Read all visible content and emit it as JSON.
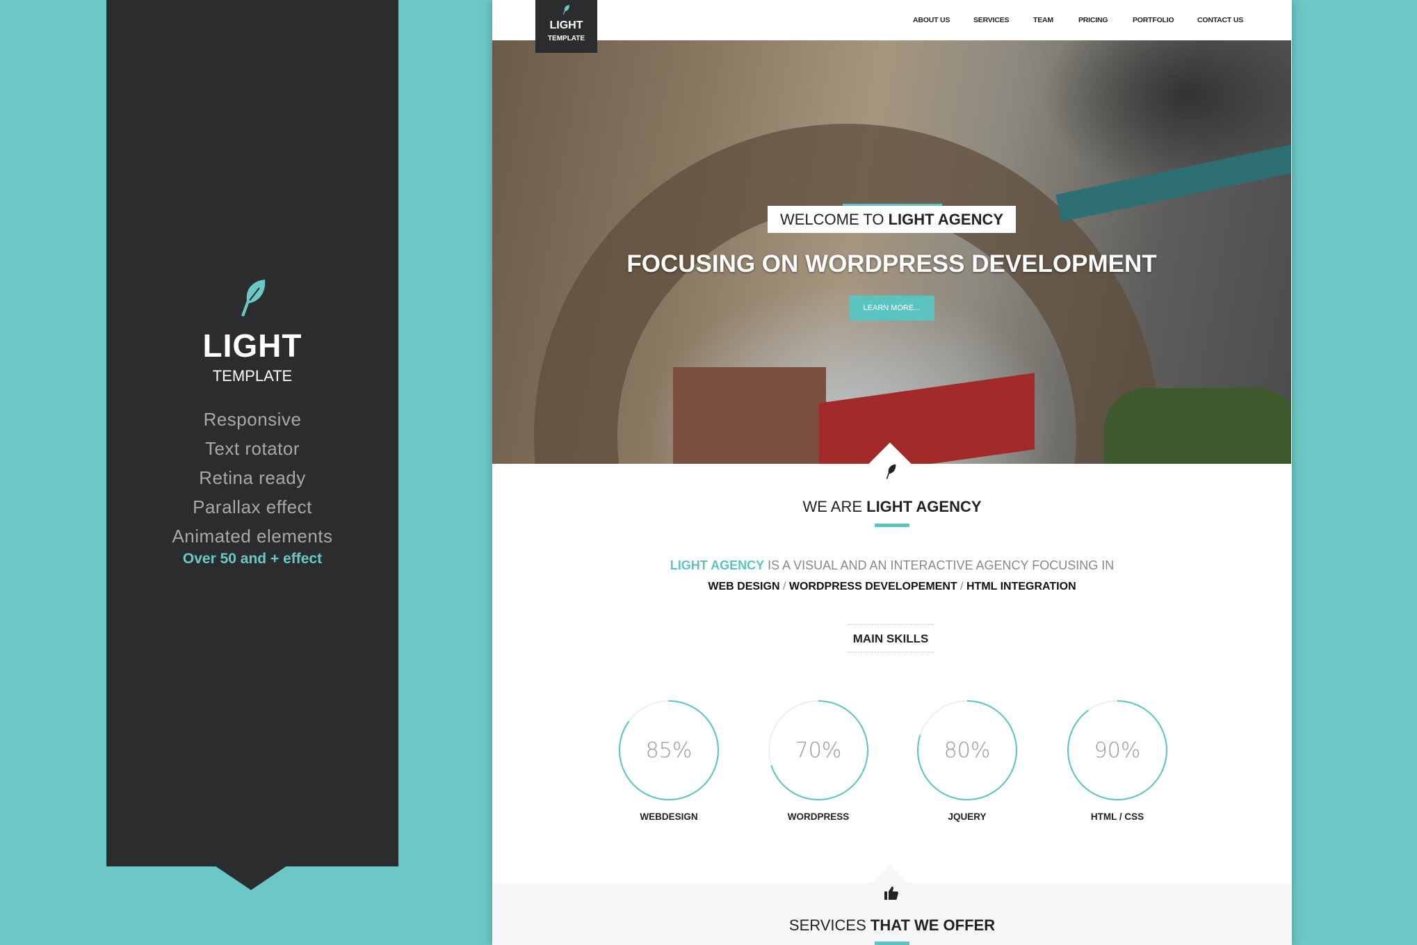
{
  "promo": {
    "title": "LIGHT",
    "subtitle": "TEMPLATE",
    "features": [
      "Responsive",
      "Text rotator",
      "Retina ready",
      "Parallax effect",
      "Animated elements"
    ],
    "extra": "Over 50 and + effect",
    "icon": "feather-icon"
  },
  "site": {
    "logo": {
      "title": "LIGHT",
      "subtitle": "TEMPLATE"
    },
    "nav": [
      "ABOUT US",
      "SERVICES",
      "TEAM",
      "PRICING",
      "PORTFOLIO",
      "CONTACT US"
    ],
    "hero": {
      "welcome_prefix": "WELCOME TO ",
      "welcome_bold": "LIGHT AGENCY",
      "heading": "FOCUSING ON WORDPRESS DEVELOPMENT",
      "button": "LEARN MORE..."
    },
    "about": {
      "title_prefix": "WE ARE ",
      "title_bold": "LIGHT AGENCY",
      "highlight": "LIGHT AGENCY",
      "text": " IS A VISUAL AND AN INTERACTIVE AGENCY FOCUSING IN",
      "focus": [
        "WEB DESIGN",
        "WORDPRESS DEVELOPEMENT",
        "HTML INTEGRATION"
      ],
      "separator": " / "
    },
    "skills": {
      "title": "MAIN SKILLS",
      "items": [
        {
          "label": "WEBDESIGN",
          "percent": 85,
          "text": "85%"
        },
        {
          "label": "WORDPRESS",
          "percent": 70,
          "text": "70%"
        },
        {
          "label": "JQUERY",
          "percent": 80,
          "text": "80%"
        },
        {
          "label": "HTML / CSS",
          "percent": 90,
          "text": "90%"
        }
      ]
    },
    "services": {
      "title_prefix": "SERVICES ",
      "title_bold": "THAT WE OFFER",
      "icon": "thumbs-up-icon"
    }
  },
  "colors": {
    "accent": "#5bc4c0",
    "background": "#6cc8c6",
    "dark": "#2b2c2e"
  }
}
